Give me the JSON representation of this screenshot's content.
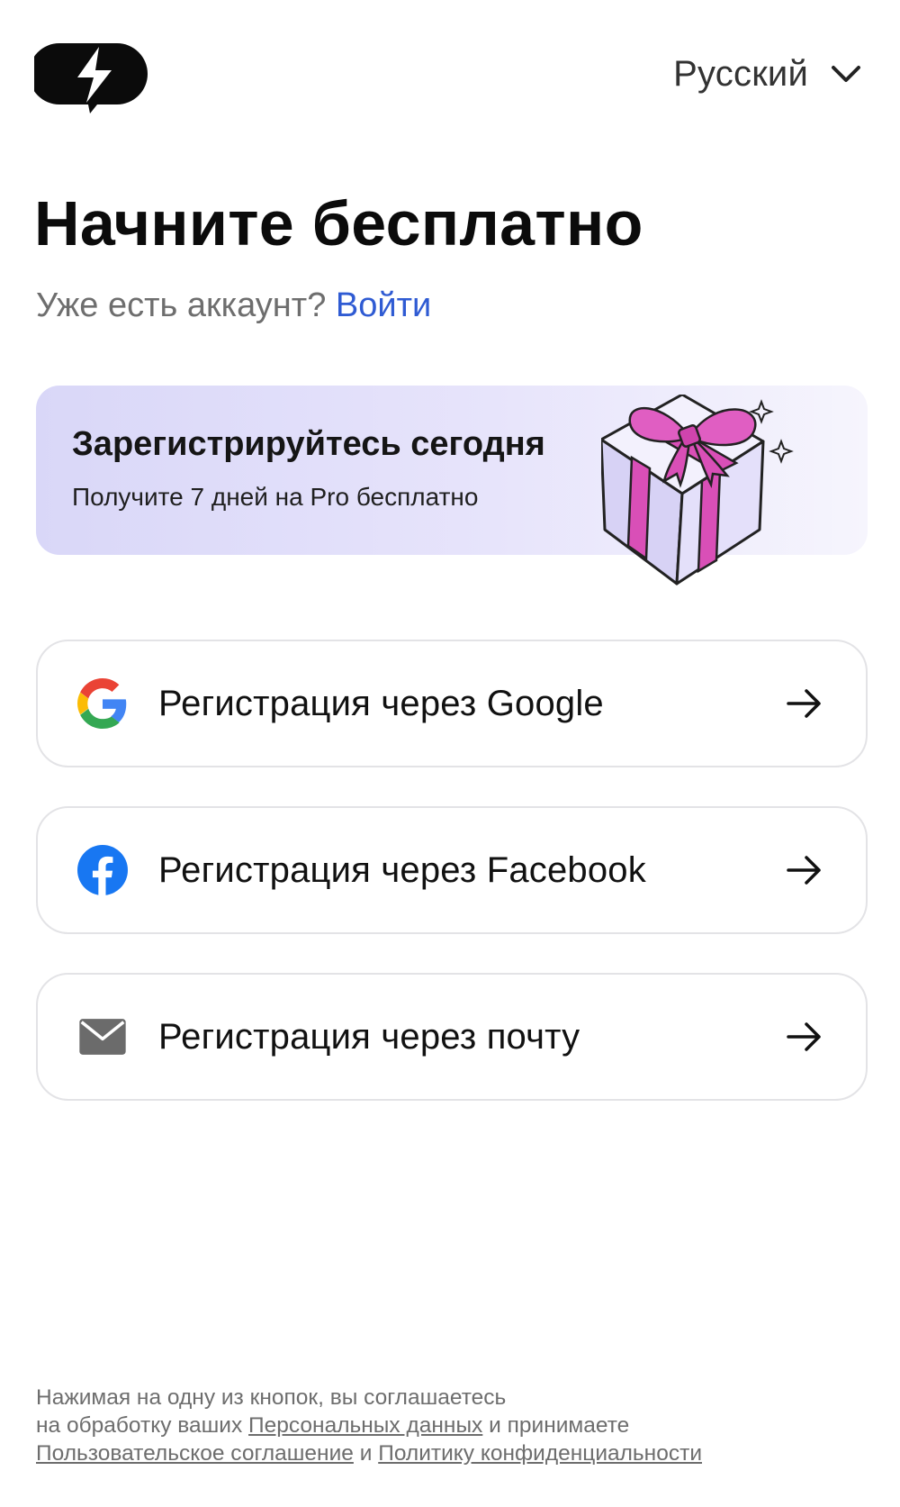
{
  "header": {
    "language": "Русский",
    "logo_icon": "lightning-bubble-logo",
    "chevron_icon": "chevron-down-icon"
  },
  "main": {
    "title": "Начните бесплатно",
    "subtitle_text": "Уже есть аккаунт?",
    "login_link": "Войти",
    "promo": {
      "title": "Зарегистрируйтесь сегодня",
      "subtitle": "Получите 7 дней на Pro бесплатно",
      "illustration": "gift-box-icon"
    },
    "buttons": [
      {
        "label": "Регистрация через Google",
        "icon": "google-icon"
      },
      {
        "label": "Регистрация через Facebook",
        "icon": "facebook-icon"
      },
      {
        "label": "Регистрация через почту",
        "icon": "mail-icon"
      }
    ]
  },
  "legal": {
    "text1": "Нажимая на одну из кнопок, вы соглашаетесь",
    "text2": "на обработку ваших",
    "link_personal": "Персональных данных",
    "text3": "и принимаете",
    "link_agreement": "Пользовательское соглашение",
    "text4": "и",
    "link_privacy": "Политику конфиденциальности"
  },
  "colors": {
    "link_blue": "#2f5bd3",
    "promo_bg": "#d9d7f8",
    "gift_pink": "#d94fb7",
    "gift_lavender": "#d7d2f5",
    "facebook_blue": "#1877f2",
    "mail_gray": "#6b6b6b"
  }
}
